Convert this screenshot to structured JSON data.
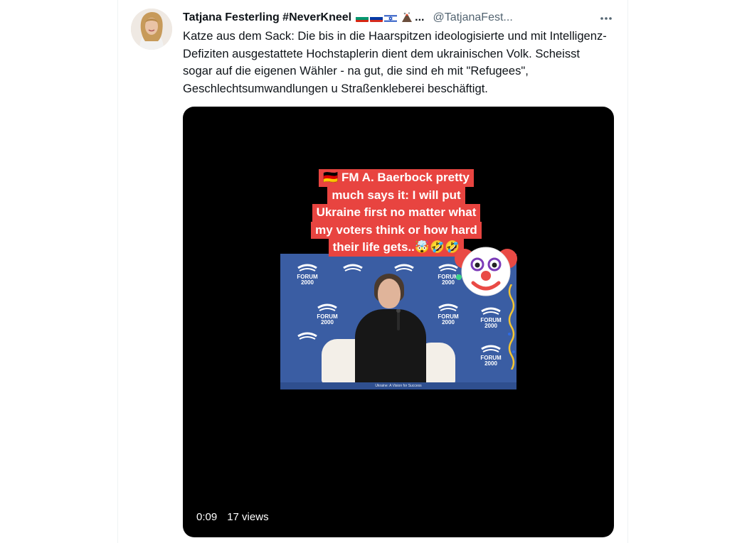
{
  "tweet": {
    "display_name": "Tatjana Festerling #NeverKneel",
    "name_ellipsis": "...",
    "handle": "@TatjanaFest...",
    "flag_icons": [
      "bulgaria-flag",
      "russia-flag",
      "israel-flag",
      "volcano-emoji"
    ],
    "text": "Katze aus dem Sack: Die bis in die Haarspitzen ideologisierte und mit Intelligenz-Defiziten ausgestattete Hochstaplerin dient dem ukrainischen Volk. Scheisst sogar auf die eigenen Wähler - na gut, die sind eh mit \"Refugees\", Geschlechtsumwandlungen u Straßenkleberei beschäftigt.",
    "more_icon": "more-horizontal-icon"
  },
  "video": {
    "caption_lines": [
      "🇩🇪 FM A. Baerbock pretty",
      "much says it: I will put",
      "Ukraine first no matter what",
      "my voters think or how hard",
      "their life gets..🤯🤣🤣"
    ],
    "backdrop_logo": [
      "FORUM",
      "2000"
    ],
    "footer_text": "Ukraine: A Vision for Success",
    "timestamp": "0:09",
    "views": "17 views",
    "colors": {
      "caption_bg": "#e84440",
      "backdrop": "#3a5da3",
      "background": "#000000"
    }
  }
}
